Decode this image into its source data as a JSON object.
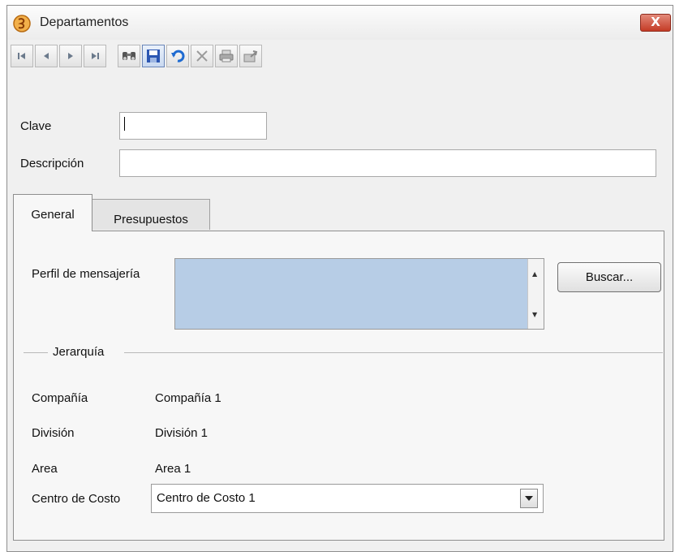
{
  "window": {
    "title": "Departamentos",
    "close_label": "X"
  },
  "toolbar": {
    "buttons": [
      {
        "name": "first-record",
        "icon": "first-record-icon"
      },
      {
        "name": "previous-record",
        "icon": "previous-record-icon"
      },
      {
        "name": "next-record",
        "icon": "next-record-icon"
      },
      {
        "name": "last-record",
        "icon": "last-record-icon"
      },
      {
        "name": "search",
        "icon": "binoculars-icon"
      },
      {
        "name": "save",
        "icon": "floppy-disk-icon"
      },
      {
        "name": "undo",
        "icon": "undo-icon"
      },
      {
        "name": "delete",
        "icon": "delete-x-icon"
      },
      {
        "name": "print",
        "icon": "printer-icon"
      },
      {
        "name": "export",
        "icon": "export-icon"
      }
    ]
  },
  "form": {
    "clave_label": "Clave",
    "clave_value": "",
    "descripcion_label": "Descripción",
    "descripcion_value": ""
  },
  "tabs": [
    {
      "label": "General",
      "active": true
    },
    {
      "label": "Presupuestos",
      "active": false
    }
  ],
  "general": {
    "perfil_label": "Perfil de mensajería",
    "buscar_label": "Buscar...",
    "jerarquia_legend": "Jerarquía",
    "compania_label": "Compañía",
    "compania_value": "Compañía 1",
    "division_label": "División",
    "division_value": "División 1",
    "area_label": "Area",
    "area_value": "Area 1",
    "centro_label": "Centro de Costo",
    "centro_value": "Centro de Costo 1"
  },
  "colors": {
    "list_selection": "#b7cde6",
    "close_button": "#c43b26",
    "window_bg": "#f0f0f0"
  }
}
